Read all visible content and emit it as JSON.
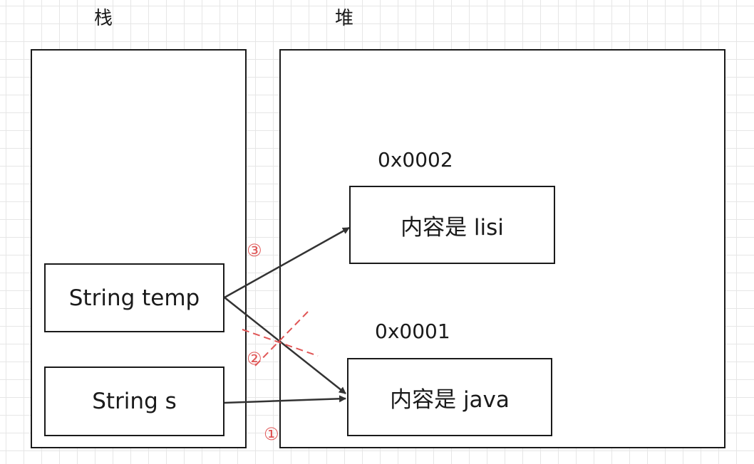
{
  "titles": {
    "stack": "栈",
    "heap": "堆"
  },
  "stack_vars": {
    "temp": "String temp",
    "s": "String s"
  },
  "heap_objects": {
    "lisi": {
      "address": "0x0002",
      "content": "内容是 lisi"
    },
    "java": {
      "address": "0x0001",
      "content": "内容是 java"
    }
  },
  "step_markers": {
    "step1": "①",
    "step2": "②",
    "step3": "③"
  },
  "colors": {
    "line": "#333333",
    "border": "#1a1a1a",
    "marker": "#e05555",
    "cross": "#e05555",
    "grid": "#e6e6e6"
  }
}
